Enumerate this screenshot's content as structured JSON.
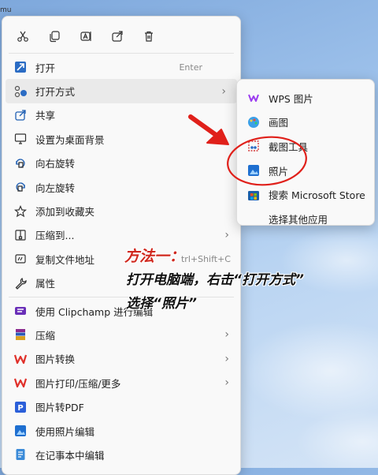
{
  "corner_text": "mu",
  "toolbar": {
    "cut_icon": "scissors-icon",
    "copy_icon": "copy-icon",
    "rename_icon": "rename-icon",
    "share_icon": "share-icon",
    "delete_icon": "trash-icon"
  },
  "menu": {
    "open": {
      "label": "打开",
      "shortcut": "Enter"
    },
    "open_with": {
      "label": "打开方式"
    },
    "share": {
      "label": "共享"
    },
    "set_wallpaper": {
      "label": "设置为桌面背景"
    },
    "rotate_right": {
      "label": "向右旋转"
    },
    "rotate_left": {
      "label": "向左旋转"
    },
    "add_favorite": {
      "label": "添加到收藏夹"
    },
    "compress": {
      "label": "压缩到..."
    },
    "copy_path": {
      "label": "复制文件地址",
      "shortcut": "trl+Shift+C"
    },
    "properties": {
      "label": "属性"
    },
    "clipchamp": {
      "label": "使用 Clipchamp 进行编辑"
    },
    "zip": {
      "label": "压缩"
    },
    "img_convert": {
      "label": "图片转换"
    },
    "img_print": {
      "label": "图片打印/压缩/更多"
    },
    "img_pdf": {
      "label": "图片转PDF"
    },
    "photo_edit": {
      "label": "使用照片编辑"
    },
    "notepad_edit": {
      "label": "在记事本中编辑"
    }
  },
  "submenu": {
    "wps": "WPS 图片",
    "paint": "画图",
    "snip": "截图工具",
    "photos": "照片",
    "store": "搜索 Microsoft Store",
    "choose_other": "选择其他应用"
  },
  "annotation": {
    "title": "方法一：",
    "line1": "打开电脑端，右击“打开方式”",
    "line2": "选择“照片”"
  },
  "colors": {
    "annotation_red": "#d0281e",
    "arrow_red": "#e0201a",
    "menu_bg": "#f9f9f9"
  }
}
